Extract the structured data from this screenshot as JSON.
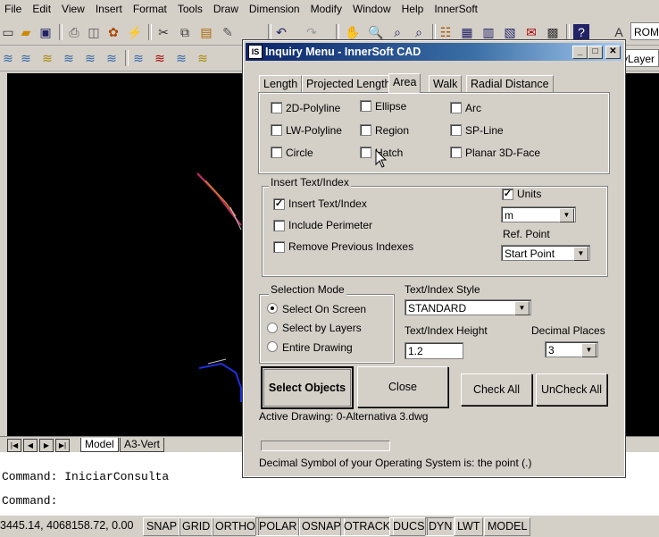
{
  "menu": [
    "File",
    "Edit",
    "View",
    "Insert",
    "Format",
    "Tools",
    "Draw",
    "Dimension",
    "Modify",
    "Window",
    "Help",
    "InnerSoft"
  ],
  "toolbar": {
    "style_field": "ROM",
    "layer_field": "yLayer"
  },
  "layout_tabs": [
    "Model",
    "A3-Vert"
  ],
  "command": {
    "line1": "Command: IniciarConsulta",
    "line2": "Command:"
  },
  "status": {
    "coords": "3445.14, 4068158.72, 0.00",
    "buttons": [
      "SNAP",
      "GRID",
      "ORTHO",
      "POLAR",
      "OSNAP",
      "OTRACK",
      "DUCS",
      "DYN",
      "LWT",
      "MODEL"
    ]
  },
  "dialog": {
    "icon_text": "IS",
    "title": "Inquiry Menu - InnerSoft CAD",
    "tabs": [
      "Length",
      "Projected Length",
      "Area",
      "Walk",
      "Radial Distance"
    ],
    "active_tab": "Area",
    "entity_types": {
      "col1": [
        "2D-Polyline",
        "LW-Polyline",
        "Circle"
      ],
      "col2": [
        "Ellipse",
        "Region",
        "Hatch"
      ],
      "col3": [
        "Arc",
        "SP-Line",
        "Planar 3D-Face"
      ]
    },
    "insert_group": {
      "legend": "Insert Text/Index",
      "options": [
        {
          "label": "Insert Text/Index",
          "checked": "✓"
        },
        {
          "label": "Include Perimeter",
          "checked": ""
        },
        {
          "label": "Remove Previous Indexes",
          "checked": ""
        }
      ],
      "units_label": "Units",
      "units_checked": "✓",
      "units_value": "m",
      "ref_point_label": "Ref. Point",
      "ref_point_value": "Start Point"
    },
    "selection": {
      "legend": "Selection Mode",
      "options": [
        "Select On Screen",
        "Select by Layers",
        "Entire Drawing"
      ],
      "selected": "Select On Screen"
    },
    "text_style_label": "Text/Index Style",
    "text_style_value": "STANDARD",
    "text_height_label": "Text/Index Height",
    "text_height_value": "1.2",
    "decimal_label": "Decimal Places",
    "decimal_value": "3",
    "buttons": {
      "select": "Select Objects",
      "close": "Close",
      "check_all": "Check All",
      "uncheck_all": "UnCheck All"
    },
    "active_drawing": "Active Drawing: 0-Alternativa 3.dwg",
    "decimal_symbol": "Decimal Symbol of your Operating System is: the point (.)"
  }
}
